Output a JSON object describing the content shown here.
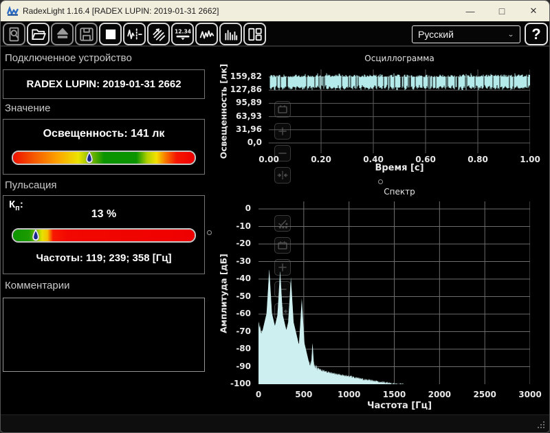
{
  "window": {
    "title": "RadexLight 1.16.4 [RADEX LUPIN: 2019-01-31 2662]",
    "controls": {
      "minimize": "—",
      "maximize": "□",
      "close": "✕"
    }
  },
  "toolbar": {
    "buttons": [
      {
        "icon": "magnifier-icon",
        "name": "preview-button",
        "enabled": false
      },
      {
        "icon": "folder-open-icon",
        "name": "open-file-button",
        "enabled": true
      },
      {
        "icon": "eject-icon",
        "name": "eject-button",
        "enabled": false
      },
      {
        "icon": "save-icon",
        "name": "save-button",
        "enabled": false
      },
      {
        "icon": "stop-icon",
        "name": "stop-button",
        "enabled": true
      },
      {
        "icon": "signal-markers-icon",
        "name": "signal-settings-button",
        "enabled": true
      },
      {
        "icon": "pulsation-icon",
        "name": "pulsation-view-button",
        "enabled": true
      },
      {
        "icon": "digital-display-icon",
        "name": "digital-view-button",
        "enabled": true
      },
      {
        "icon": "oscillogram-icon",
        "name": "oscillogram-view-button",
        "enabled": true
      },
      {
        "icon": "spectrum-icon",
        "name": "spectrum-view-button",
        "enabled": true
      },
      {
        "icon": "layout-icon",
        "name": "layout-button",
        "enabled": true
      }
    ],
    "language_value": "Русский",
    "help_label": "?"
  },
  "device_panel": {
    "header": "Подключенное устройство",
    "device_name": "RADEX LUPIN: 2019-01-31 2662"
  },
  "value_panel": {
    "header": "Значение",
    "reading": "Освещенность: 141 лк",
    "marker_percent": 42,
    "gradient": [
      [
        "0%",
        "#ee1000"
      ],
      [
        "12%",
        "#f65c00"
      ],
      [
        "25%",
        "#fca600"
      ],
      [
        "36%",
        "#ece400"
      ],
      [
        "44%",
        "#6cb400"
      ],
      [
        "50%",
        "#0c9400"
      ],
      [
        "68%",
        "#0c9400"
      ],
      [
        "74%",
        "#b4d200"
      ],
      [
        "79%",
        "#f4e000"
      ],
      [
        "84%",
        "#f87800"
      ],
      [
        "90%",
        "#f61600"
      ],
      [
        "100%",
        "#ee0000"
      ]
    ]
  },
  "pulsation_panel": {
    "header": "Пульсация",
    "kp_main": "К",
    "kp_sub": "п",
    "kp_colon": ":",
    "kp_value": "13 %",
    "marker_percent": 12.5,
    "gradient": [
      [
        "0%",
        "#0c9400"
      ],
      [
        "9%",
        "#1e9c00"
      ],
      [
        "13%",
        "#86c400"
      ],
      [
        "16%",
        "#e6e200"
      ],
      [
        "19%",
        "#f6c000"
      ],
      [
        "22%",
        "#f81800"
      ],
      [
        "30%",
        "#f20800"
      ],
      [
        "100%",
        "#ee0000"
      ]
    ],
    "frequencies": "Частоты: 119; 239; 358 [Гц]"
  },
  "comments_panel": {
    "header": "Комментарии",
    "text": ""
  },
  "chart_data": [
    {
      "type": "line",
      "title": "Осциллограмма",
      "ylabel": "Освещенность [лк]",
      "xlabel": "Время [с]",
      "yticks": [
        {
          "label": "159,82",
          "value": 159.82
        },
        {
          "label": "127,86",
          "value": 127.86
        },
        {
          "label": "95,89",
          "value": 95.89
        },
        {
          "label": "63,93",
          "value": 63.93
        },
        {
          "label": "31,96",
          "value": 31.96
        },
        {
          "label": "0,0",
          "value": 0
        }
      ],
      "xticks": [
        {
          "label": "0.00",
          "value": 0.0
        },
        {
          "label": "0.20",
          "value": 0.2
        },
        {
          "label": "0.40",
          "value": 0.4
        },
        {
          "label": "0.60",
          "value": 0.6
        },
        {
          "label": "0.80",
          "value": 0.8
        },
        {
          "label": "1.00",
          "value": 1.0
        }
      ],
      "xlim": [
        0,
        1
      ],
      "ylim": [
        -25,
        178
      ],
      "grid": true,
      "series_color": "#b5eaea",
      "signal": {
        "kind": "pulsed-band",
        "top_lux": 160,
        "bottom_min_lux": 128,
        "bottom_max_lux": 142,
        "mean_lux": 141
      },
      "tools": [
        "frame-icon",
        "zoom-in-icon",
        "zoom-out-icon",
        "fit-horizontal-icon"
      ]
    },
    {
      "type": "area",
      "title": "Спектр",
      "ylabel": "Амплитуда [дБ]",
      "xlabel": "Частота [Гц]",
      "yticks": [
        {
          "label": "0",
          "value": 0
        },
        {
          "label": "-10",
          "value": -10
        },
        {
          "label": "-20",
          "value": -20
        },
        {
          "label": "-30",
          "value": -30
        },
        {
          "label": "-40",
          "value": -40
        },
        {
          "label": "-50",
          "value": -50
        },
        {
          "label": "-60",
          "value": -60
        },
        {
          "label": "-70",
          "value": -70
        },
        {
          "label": "-80",
          "value": -80
        },
        {
          "label": "-90",
          "value": -90
        },
        {
          "label": "-100",
          "value": -100
        }
      ],
      "xticks": [
        {
          "label": "0",
          "value": 0
        },
        {
          "label": "500",
          "value": 500
        },
        {
          "label": "1000",
          "value": 1000
        },
        {
          "label": "1500",
          "value": 1500
        },
        {
          "label": "2000",
          "value": 2000
        },
        {
          "label": "2500",
          "value": 2500
        },
        {
          "label": "3000",
          "value": 3000
        }
      ],
      "xlim": [
        0,
        3000
      ],
      "ylim": [
        -100,
        0
      ],
      "grid": true,
      "fill_color": "#cdeff0",
      "peaks": [
        {
          "freq_hz": 119,
          "db": -34
        },
        {
          "freq_hz": 239,
          "db": -35
        },
        {
          "freq_hz": 358,
          "db": -39
        },
        {
          "freq_hz": 478,
          "db": -51
        },
        {
          "freq_hz": 597,
          "db": -76
        }
      ],
      "noise_floor": [
        [
          0,
          -65
        ],
        [
          30,
          -70
        ],
        [
          90,
          -71
        ],
        [
          160,
          -79
        ],
        [
          230,
          -80
        ],
        [
          300,
          -83
        ],
        [
          380,
          -85
        ],
        [
          460,
          -87
        ],
        [
          550,
          -88
        ],
        [
          595,
          -89
        ],
        [
          620,
          -90
        ],
        [
          700,
          -92
        ],
        [
          800,
          -93.5
        ],
        [
          1000,
          -95.5
        ],
        [
          1200,
          -97.5
        ],
        [
          1400,
          -99
        ],
        [
          1550,
          -100
        ]
      ],
      "data_end_hz": 1600,
      "tools": [
        "auto-scale-icon",
        "frame-icon",
        "zoom-in-icon",
        "zoom-out-icon",
        "fit-horizontal-icon"
      ]
    }
  ]
}
